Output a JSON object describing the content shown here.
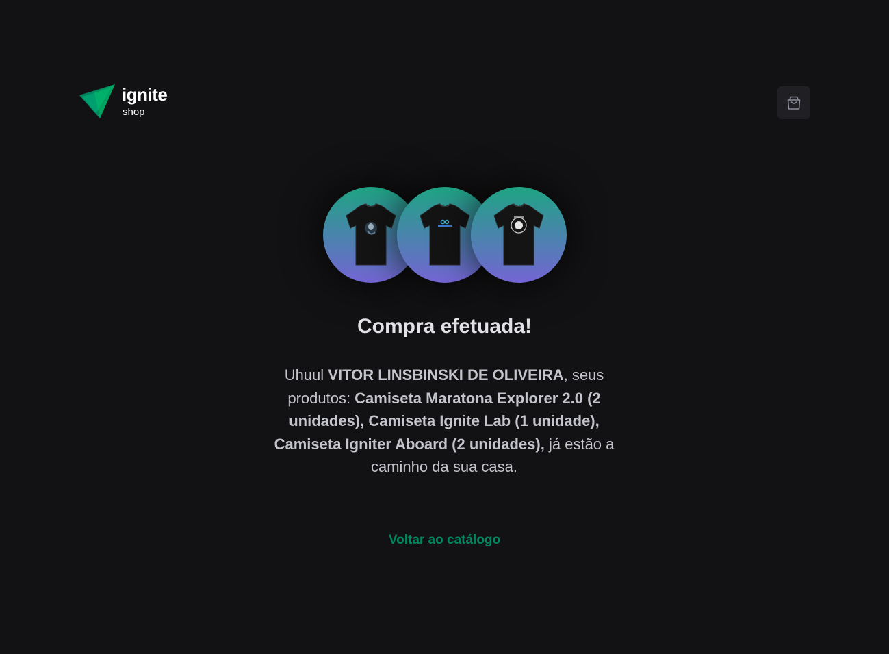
{
  "header": {
    "logo_word": "ignite",
    "logo_sub": "shop"
  },
  "products": [
    {
      "name": "Camiseta Maratona Explorer 2.0",
      "icon": "tshirt-explorer-icon"
    },
    {
      "name": "Camiseta Ignite Lab",
      "icon": "tshirt-ignite-lab-icon"
    },
    {
      "name": "Camiseta Igniter Aboard",
      "icon": "tshirt-igniter-aboard-icon"
    }
  ],
  "main": {
    "title": "Compra efetuada!",
    "message": {
      "greeting": "Uhuul ",
      "customer_name": "VITOR LINSBINSKI DE OLIVEIRA",
      "after_name": ", seus produtos: ",
      "items": "Camiseta Maratona Explorer 2.0 (2 unidades), Camiseta Ignite Lab (1 unidade), Camiseta Igniter Aboard (2 unidades),",
      "ending": " já estão a caminho da sua casa."
    },
    "back_link": "Voltar ao catálogo"
  },
  "colors": {
    "background": "#121214",
    "accent": "#00875f",
    "gradient_start": "#1ea483",
    "gradient_end": "#7465d4"
  }
}
